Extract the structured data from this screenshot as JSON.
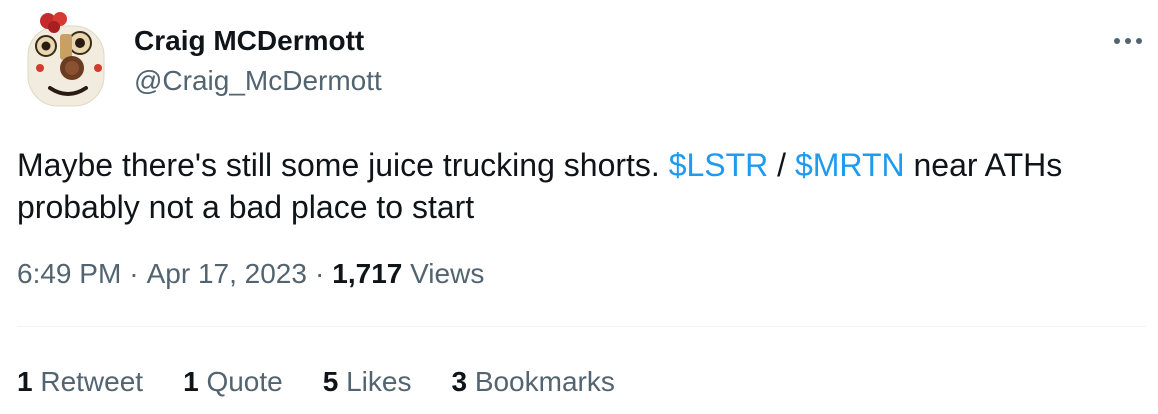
{
  "author": {
    "display_name": "Craig MCDermott",
    "handle": "@Craig_McDermott"
  },
  "tweet": {
    "text_part1": "Maybe there's still some juice trucking shorts. ",
    "cashtag1": "$LSTR",
    "text_separator": " / ",
    "cashtag2": "$MRTN",
    "text_part2": " near ATHs probably not a bad place to start"
  },
  "meta": {
    "time": "6:49 PM",
    "dot1": "·",
    "date": "Apr 17, 2023",
    "dot2": "·",
    "views_count": "1,717",
    "views_label": "Views"
  },
  "stats": {
    "retweets": {
      "count": "1",
      "label": "Retweet"
    },
    "quotes": {
      "count": "1",
      "label": "Quote"
    },
    "likes": {
      "count": "5",
      "label": "Likes"
    },
    "bookmarks": {
      "count": "3",
      "label": "Bookmarks"
    }
  },
  "icons": {
    "more": "more-horizontal-icon",
    "avatar": "avatar-image"
  },
  "colors": {
    "link": "#1d9bf0",
    "secondary_text": "#536471",
    "primary_text": "#0f1419",
    "divider": "#eff3f4"
  }
}
